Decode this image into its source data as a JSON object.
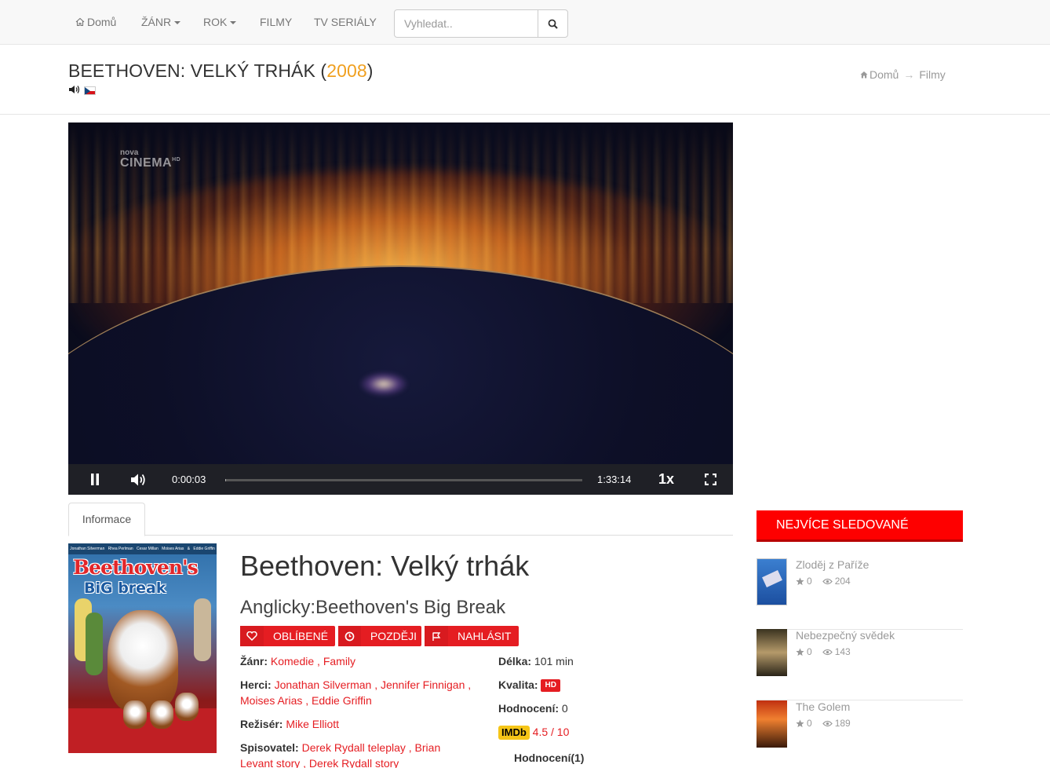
{
  "nav": {
    "home": "Domů",
    "genre": "ŽÁNR",
    "year": "ROK",
    "films": "FILMY",
    "series": "TV SERIÁLY",
    "search_placeholder": "Vyhledat.."
  },
  "header": {
    "title": "BEETHOVEN: VELKÝ TRHÁK (",
    "year": "2008",
    "title_close": ")",
    "breadcrumb_home": "Domů",
    "breadcrumb_arrow": "→",
    "breadcrumb_current": "Filmy"
  },
  "player": {
    "channel_top": "nova",
    "channel_name": "CINEMA",
    "channel_hd": "HD",
    "current_time": "0:00:03",
    "duration": "1:33:14",
    "speed": "1x",
    "progress_fraction": 0.0005
  },
  "tabs": {
    "info": "Informace"
  },
  "poster": {
    "names": [
      "Jonathan Silverman",
      "Rhea Perlman",
      "Cesar Millan",
      "Moises Arias",
      "&",
      "Eddie Griffin"
    ],
    "title_line1": "Beethoven's",
    "title_line2": "BiG break"
  },
  "movie": {
    "title": "Beethoven: Velký trhák",
    "original_title": "Anglicky:Beethoven's Big Break",
    "buttons": {
      "favorite": "OBLÍBENÉ",
      "later": "POZDĚJI",
      "report": "NAHLÁSIT"
    },
    "genre_label": "Žánr:",
    "genres": "Komedie , Family",
    "actors_label": "Herci:",
    "actors_line1": "Jonathan Silverman , Jennifer Finnigan ,",
    "actors_line2": "Moises Arias , Eddie Griffin",
    "director_label": "Režisér:",
    "director": "Mike Elliott",
    "writer_label": "Spisovatel:",
    "writers_line1": "Derek Rydall teleplay , Brian",
    "writers_line2": "Levant story , Derek Rydall story",
    "length_label": "Délka:",
    "length": "101 min",
    "quality_label": "Kvalita:",
    "quality": "HD",
    "rating_label": "Hodnocení:",
    "rating": "0",
    "imdb_label": "IMDb",
    "imdb_score": "4.5 / 10",
    "ratings_count": "Hodnocení(1)"
  },
  "sidebar": {
    "heading": "NEJVÍCE SLEDOVANÉ",
    "items": [
      {
        "title": "Zloděj z Paříže",
        "rating": "0",
        "views": "204"
      },
      {
        "title": "Nebezpečný svědek",
        "rating": "0",
        "views": "143"
      },
      {
        "title": "The Golem",
        "rating": "0",
        "views": "189"
      }
    ]
  },
  "colors": {
    "accent_red": "#e51d22",
    "year_orange": "#f0a020",
    "sidebar_red": "#fe0000",
    "imdb_yellow": "#f5c518"
  }
}
